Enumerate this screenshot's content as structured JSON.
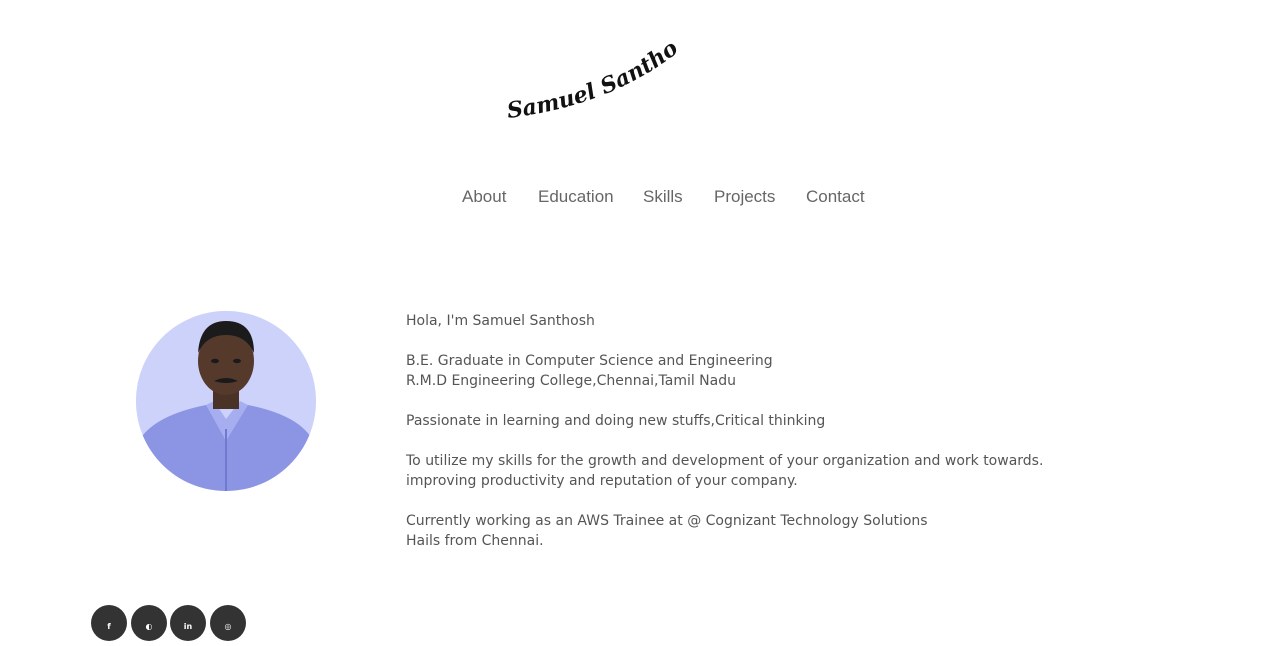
{
  "logo": {
    "text": "Samuel Santhosh"
  },
  "nav": {
    "items": [
      {
        "label": "About"
      },
      {
        "label": "Education"
      },
      {
        "label": "Skills"
      },
      {
        "label": "Projects"
      },
      {
        "label": "Contact"
      }
    ]
  },
  "about": {
    "greeting": "Hola, I'm Samuel Santhosh",
    "degree": "B.E. Graduate in Computer Science and Engineering",
    "college": "R.M.D Engineering College,Chennai,Tamil Nadu",
    "passion": "Passionate in learning and doing new stuffs,Critical thinking",
    "objective_line1": "To utilize my skills for the growth and development of your organization and work towards.",
    "objective_line2": "improving productivity and reputation of your company.",
    "current_role": "Currently working as an AWS Trainee at @ Cognizant Technology Solutions",
    "hometown": "Hails from Chennai."
  },
  "social": {
    "items": [
      {
        "icon": "facebook-icon",
        "glyph": "f"
      },
      {
        "icon": "github-icon",
        "glyph": "◐"
      },
      {
        "icon": "linkedin-icon",
        "glyph": "in"
      },
      {
        "icon": "instagram-icon",
        "glyph": "◎"
      }
    ]
  },
  "colors": {
    "nav_text": "#666666",
    "body_text": "#555555",
    "social_bg": "#333333",
    "avatar_bg": "#cdd2fb"
  }
}
